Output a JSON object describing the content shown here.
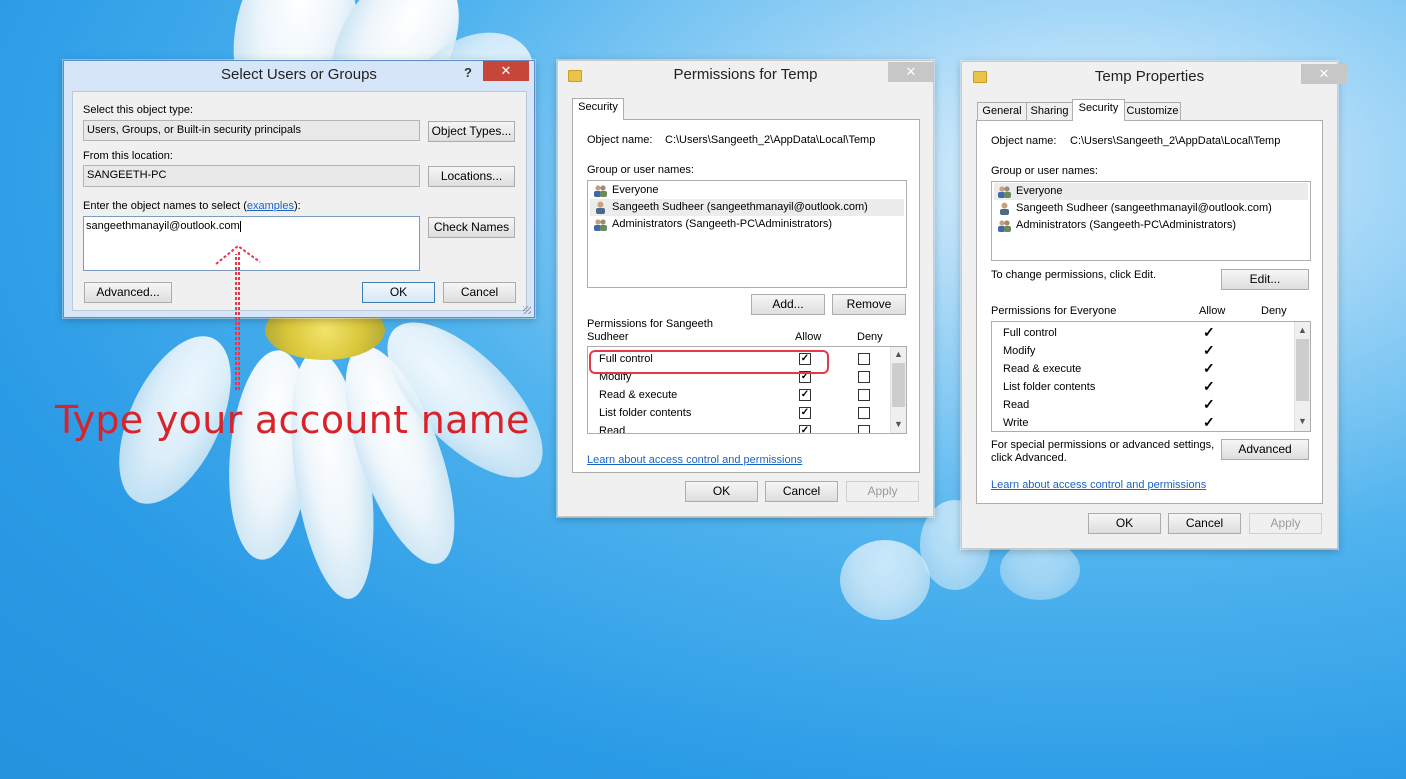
{
  "select_dialog": {
    "title": "Select Users or Groups",
    "help": "?",
    "close": "✕",
    "object_type_label": "Select this object type:",
    "object_type_value": "Users, Groups, or Built-in security principals",
    "object_types_button": "Object Types...",
    "location_label": "From this location:",
    "location_value": "SANGEETH-PC",
    "locations_button": "Locations...",
    "names_label_prefix": "Enter the object names to select (",
    "names_label_link": "examples",
    "names_label_suffix": "):",
    "names_value": "sangeethmanayil@outlook.com",
    "check_names_button": "Check Names",
    "advanced_button": "Advanced...",
    "ok_button": "OK",
    "cancel_button": "Cancel"
  },
  "annotation": {
    "text": "Type your account name",
    "color": "#d8232a"
  },
  "permissions_dialog": {
    "title": "Permissions for Temp",
    "close": "✕",
    "tab": "Security",
    "object_name_label": "Object name:",
    "object_name_value": "C:\\Users\\Sangeeth_2\\AppData\\Local\\Temp",
    "group_label": "Group or user names:",
    "users": [
      {
        "name": "Everyone",
        "icon": "group-icon"
      },
      {
        "name": "Sangeeth Sudheer (sangeethmanayil@outlook.com)",
        "icon": "user-icon"
      },
      {
        "name": "Administrators (Sangeeth-PC\\Administrators)",
        "icon": "group-icon"
      }
    ],
    "add_button": "Add...",
    "remove_button": "Remove",
    "permissions_label_line1": "Permissions for Sangeeth",
    "permissions_label_line2": "Sudheer",
    "allow_header": "Allow",
    "deny_header": "Deny",
    "permissions": [
      {
        "name": "Full control",
        "allow": true,
        "deny": false
      },
      {
        "name": "Modify",
        "allow": true,
        "deny": false
      },
      {
        "name": "Read & execute",
        "allow": true,
        "deny": false
      },
      {
        "name": "List folder contents",
        "allow": true,
        "deny": false
      },
      {
        "name": "Read",
        "allow": true,
        "deny": false
      }
    ],
    "learn_link": "Learn about access control and permissions",
    "ok_button": "OK",
    "cancel_button": "Cancel",
    "apply_button": "Apply"
  },
  "properties_dialog": {
    "title": "Temp Properties",
    "close": "✕",
    "tabs": [
      "General",
      "Sharing",
      "Security",
      "Customize"
    ],
    "active_tab": "Security",
    "object_name_label": "Object name:",
    "object_name_value": "C:\\Users\\Sangeeth_2\\AppData\\Local\\Temp",
    "group_label": "Group or user names:",
    "users": [
      {
        "name": "Everyone",
        "icon": "group-icon"
      },
      {
        "name": "Sangeeth Sudheer (sangeethmanayil@outlook.com)",
        "icon": "user-icon"
      },
      {
        "name": "Administrators (Sangeeth-PC\\Administrators)",
        "icon": "group-icon"
      }
    ],
    "change_text": "To change permissions, click Edit.",
    "edit_button": "Edit...",
    "permissions_label": "Permissions for Everyone",
    "allow_header": "Allow",
    "deny_header": "Deny",
    "permissions": [
      {
        "name": "Full control",
        "allow": true
      },
      {
        "name": "Modify",
        "allow": true
      },
      {
        "name": "Read & execute",
        "allow": true
      },
      {
        "name": "List folder contents",
        "allow": true
      },
      {
        "name": "Read",
        "allow": true
      },
      {
        "name": "Write",
        "allow": true
      }
    ],
    "special_text_line1": "For special permissions or advanced settings,",
    "special_text_line2": "click Advanced.",
    "advanced_button": "Advanced",
    "learn_link": "Learn about access control and permissions",
    "ok_button": "OK",
    "cancel_button": "Cancel",
    "apply_button": "Apply"
  }
}
